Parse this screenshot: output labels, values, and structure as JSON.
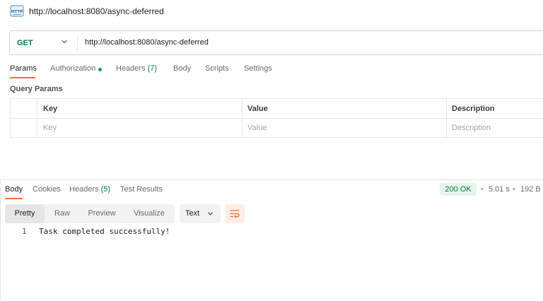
{
  "request": {
    "title": "http://localhost:8080/async-deferred",
    "icon": "http-icon",
    "method": "GET",
    "url": "http://localhost:8080/async-deferred"
  },
  "request_tabs": {
    "params": "Params",
    "authorization": "Authorization",
    "headers": "Headers",
    "headers_count": "(7)",
    "body": "Body",
    "scripts": "Scripts",
    "settings": "Settings"
  },
  "query_params": {
    "heading": "Query Params",
    "columns": [
      "Key",
      "Value",
      "Description"
    ],
    "placeholders": [
      "Key",
      "Value",
      "Description"
    ]
  },
  "response_tabs": {
    "body": "Body",
    "cookies": "Cookies",
    "headers": "Headers",
    "headers_count": "(5)",
    "test_results": "Test Results"
  },
  "response_meta": {
    "status": "200 OK",
    "time": "5.01 s",
    "size": "192 B",
    "sep": "•"
  },
  "view_modes": [
    "Pretty",
    "Raw",
    "Preview",
    "Visualize"
  ],
  "format": "Text",
  "response_body": {
    "line_number": "1",
    "text": "Task completed successfully!"
  },
  "colors": {
    "accent": "#ff6c37",
    "status_green": "#0a7a45",
    "method_green": "#0a7a45"
  }
}
